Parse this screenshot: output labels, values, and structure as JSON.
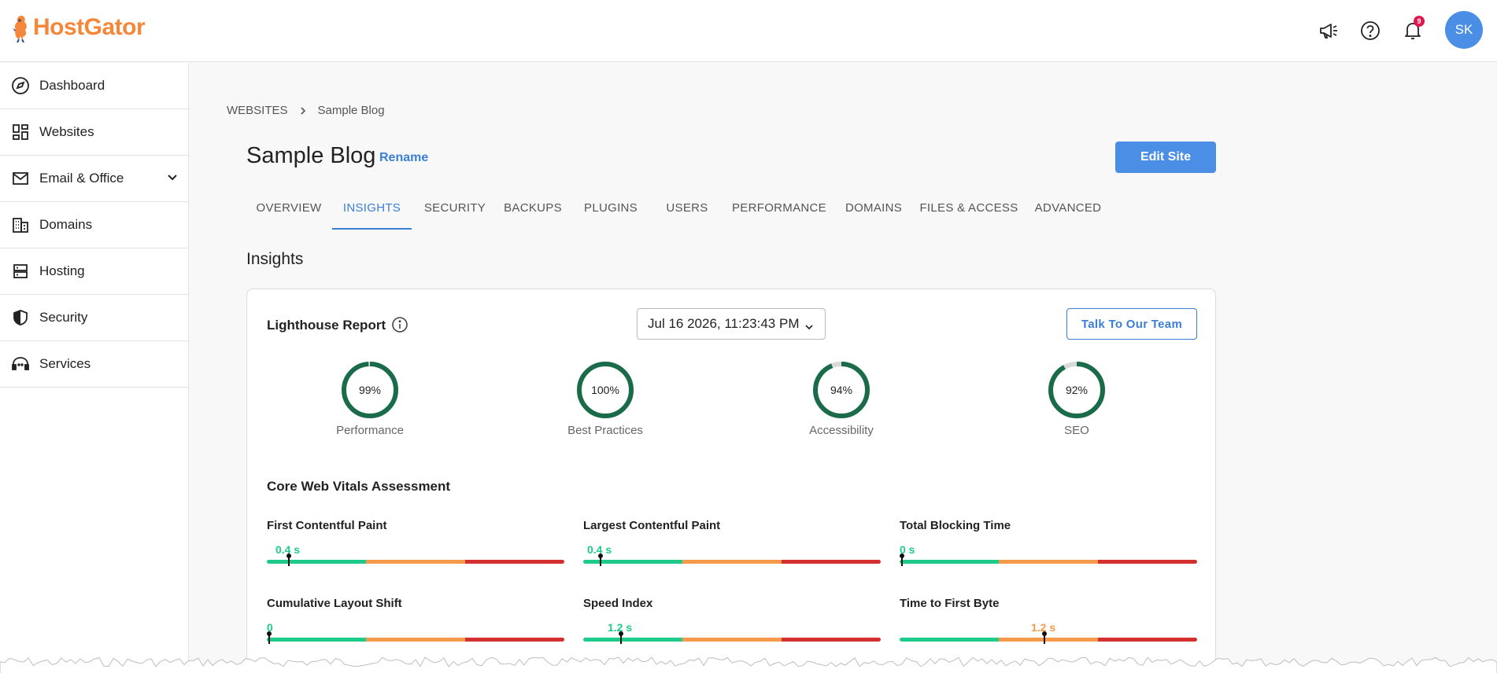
{
  "brand": {
    "name": "HostGator",
    "color": "#f4873a"
  },
  "header": {
    "icons": [
      "megaphone-icon",
      "help-icon",
      "bell-icon"
    ],
    "notification_count": "9",
    "avatar_initials": "SK"
  },
  "sidebar": {
    "items": [
      {
        "label": "Dashboard",
        "icon": "compass-icon"
      },
      {
        "label": "Websites",
        "icon": "grid-icon"
      },
      {
        "label": "Email & Office",
        "icon": "mail-icon",
        "expandable": true
      },
      {
        "label": "Domains",
        "icon": "building-icon"
      },
      {
        "label": "Hosting",
        "icon": "server-icon"
      },
      {
        "label": "Security",
        "icon": "shield-icon"
      },
      {
        "label": "Services",
        "icon": "headset-icon"
      }
    ]
  },
  "breadcrumb": {
    "root": "WEBSITES",
    "current": "Sample Blog"
  },
  "site": {
    "title": "Sample Blog",
    "rename_label": "Rename",
    "edit_label": "Edit Site"
  },
  "tabs": [
    {
      "label": "OVERVIEW"
    },
    {
      "label": "INSIGHTS",
      "active": true
    },
    {
      "label": "SECURITY"
    },
    {
      "label": "BACKUPS"
    },
    {
      "label": "PLUGINS"
    },
    {
      "label": "USERS"
    },
    {
      "label": "PERFORMANCE"
    },
    {
      "label": "DOMAINS"
    },
    {
      "label": "FILES & ACCESS"
    },
    {
      "label": "ADVANCED"
    }
  ],
  "insights": {
    "section_title": "Insights",
    "lighthouse_title": "Lighthouse Report",
    "report_date": "Jul 16 2026, 11:23:43 PM",
    "talk_label": "Talk To Our Team",
    "scores": [
      {
        "label": "Performance",
        "display": "99%",
        "value": 99
      },
      {
        "label": "Best Practices",
        "display": "100%",
        "value": 100
      },
      {
        "label": "Accessibility",
        "display": "94%",
        "value": 94
      },
      {
        "label": "SEO",
        "display": "92%",
        "value": 92
      }
    ],
    "cwv_title": "Core Web Vitals Assessment",
    "metrics": [
      {
        "name": "First Contentful Paint",
        "value": "0.4 s",
        "position": 0.067,
        "status": "good"
      },
      {
        "name": "Largest Contentful Paint",
        "value": "0.4 s",
        "position": 0.05,
        "status": "good"
      },
      {
        "name": "Total Blocking Time",
        "value": "0 s",
        "position": 0.0,
        "status": "good"
      },
      {
        "name": "Cumulative Layout Shift",
        "value": "0",
        "position": 0.0,
        "status": "good"
      },
      {
        "name": "Speed Index",
        "value": "1.2 s",
        "position": 0.12,
        "status": "good"
      },
      {
        "name": "Time to First Byte",
        "value": "1.2 s",
        "position": 0.48,
        "status": "average"
      }
    ]
  },
  "colors": {
    "accent": "#3a7fd6",
    "gauge": "#1a6b4a",
    "gauge_track": "#d9d9d9",
    "good": "#1fcb8a",
    "average": "#f59a4a",
    "poor": "#d3302f"
  }
}
